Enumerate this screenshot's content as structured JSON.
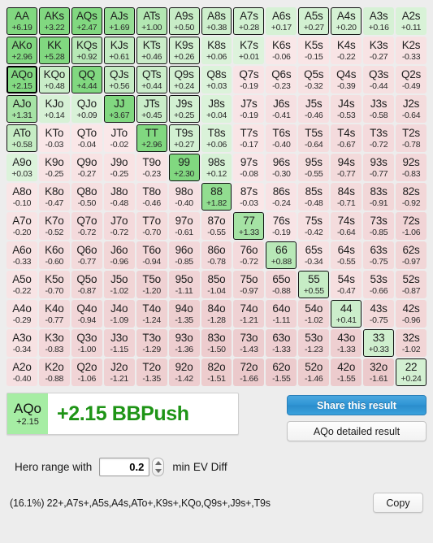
{
  "grid": {
    "rows": [
      [
        {
          "hand": "AA",
          "ev": "+6.19",
          "sel": true
        },
        {
          "hand": "AKs",
          "ev": "+3.22",
          "sel": true
        },
        {
          "hand": "AQs",
          "ev": "+2.47",
          "sel": true
        },
        {
          "hand": "AJs",
          "ev": "+1.69",
          "sel": true
        },
        {
          "hand": "ATs",
          "ev": "+1.00",
          "sel": true
        },
        {
          "hand": "A9s",
          "ev": "+0.50",
          "sel": true
        },
        {
          "hand": "A8s",
          "ev": "+0.38",
          "sel": true
        },
        {
          "hand": "A7s",
          "ev": "+0.28",
          "sel": true
        },
        {
          "hand": "A6s",
          "ev": "+0.17",
          "sel": false
        },
        {
          "hand": "A5s",
          "ev": "+0.27",
          "sel": true
        },
        {
          "hand": "A4s",
          "ev": "+0.20",
          "sel": true
        },
        {
          "hand": "A3s",
          "ev": "+0.16",
          "sel": false
        },
        {
          "hand": "A2s",
          "ev": "+0.11",
          "sel": false
        }
      ],
      [
        {
          "hand": "AKo",
          "ev": "+2.96",
          "sel": true
        },
        {
          "hand": "KK",
          "ev": "+5.28",
          "sel": true
        },
        {
          "hand": "KQs",
          "ev": "+0.92",
          "sel": true
        },
        {
          "hand": "KJs",
          "ev": "+0.61",
          "sel": true
        },
        {
          "hand": "KTs",
          "ev": "+0.46",
          "sel": true
        },
        {
          "hand": "K9s",
          "ev": "+0.26",
          "sel": true
        },
        {
          "hand": "K8s",
          "ev": "+0.06",
          "sel": false
        },
        {
          "hand": "K7s",
          "ev": "+0.01",
          "sel": false
        },
        {
          "hand": "K6s",
          "ev": "-0.06",
          "sel": false
        },
        {
          "hand": "K5s",
          "ev": "-0.15",
          "sel": false
        },
        {
          "hand": "K4s",
          "ev": "-0.22",
          "sel": false
        },
        {
          "hand": "K3s",
          "ev": "-0.27",
          "sel": false
        },
        {
          "hand": "K2s",
          "ev": "-0.33",
          "sel": false
        }
      ],
      [
        {
          "hand": "AQo",
          "ev": "+2.15",
          "sel": true,
          "focus": true
        },
        {
          "hand": "KQo",
          "ev": "+0.48",
          "sel": true
        },
        {
          "hand": "QQ",
          "ev": "+4.44",
          "sel": true
        },
        {
          "hand": "QJs",
          "ev": "+0.56",
          "sel": true
        },
        {
          "hand": "QTs",
          "ev": "+0.44",
          "sel": true
        },
        {
          "hand": "Q9s",
          "ev": "+0.24",
          "sel": true
        },
        {
          "hand": "Q8s",
          "ev": "+0.03",
          "sel": false
        },
        {
          "hand": "Q7s",
          "ev": "-0.19",
          "sel": false
        },
        {
          "hand": "Q6s",
          "ev": "-0.23",
          "sel": false
        },
        {
          "hand": "Q5s",
          "ev": "-0.32",
          "sel": false
        },
        {
          "hand": "Q4s",
          "ev": "-0.39",
          "sel": false
        },
        {
          "hand": "Q3s",
          "ev": "-0.44",
          "sel": false
        },
        {
          "hand": "Q2s",
          "ev": "-0.49",
          "sel": false
        }
      ],
      [
        {
          "hand": "AJo",
          "ev": "+1.31",
          "sel": true
        },
        {
          "hand": "KJo",
          "ev": "+0.14",
          "sel": false
        },
        {
          "hand": "QJo",
          "ev": "+0.09",
          "sel": false
        },
        {
          "hand": "JJ",
          "ev": "+3.67",
          "sel": true
        },
        {
          "hand": "JTs",
          "ev": "+0.45",
          "sel": true
        },
        {
          "hand": "J9s",
          "ev": "+0.25",
          "sel": true
        },
        {
          "hand": "J8s",
          "ev": "+0.04",
          "sel": false
        },
        {
          "hand": "J7s",
          "ev": "-0.19",
          "sel": false
        },
        {
          "hand": "J6s",
          "ev": "-0.41",
          "sel": false
        },
        {
          "hand": "J5s",
          "ev": "-0.46",
          "sel": false
        },
        {
          "hand": "J4s",
          "ev": "-0.53",
          "sel": false
        },
        {
          "hand": "J3s",
          "ev": "-0.58",
          "sel": false
        },
        {
          "hand": "J2s",
          "ev": "-0.64",
          "sel": false
        }
      ],
      [
        {
          "hand": "ATo",
          "ev": "+0.58",
          "sel": true
        },
        {
          "hand": "KTo",
          "ev": "-0.03",
          "sel": false
        },
        {
          "hand": "QTo",
          "ev": "-0.04",
          "sel": false
        },
        {
          "hand": "JTo",
          "ev": "-0.02",
          "sel": false
        },
        {
          "hand": "TT",
          "ev": "+2.96",
          "sel": true
        },
        {
          "hand": "T9s",
          "ev": "+0.27",
          "sel": true
        },
        {
          "hand": "T8s",
          "ev": "+0.06",
          "sel": false
        },
        {
          "hand": "T7s",
          "ev": "-0.17",
          "sel": false
        },
        {
          "hand": "T6s",
          "ev": "-0.40",
          "sel": false
        },
        {
          "hand": "T5s",
          "ev": "-0.64",
          "sel": false
        },
        {
          "hand": "T4s",
          "ev": "-0.67",
          "sel": false
        },
        {
          "hand": "T3s",
          "ev": "-0.72",
          "sel": false
        },
        {
          "hand": "T2s",
          "ev": "-0.78",
          "sel": false
        }
      ],
      [
        {
          "hand": "A9o",
          "ev": "+0.03",
          "sel": false
        },
        {
          "hand": "K9o",
          "ev": "-0.25",
          "sel": false
        },
        {
          "hand": "Q9o",
          "ev": "-0.27",
          "sel": false
        },
        {
          "hand": "J9o",
          "ev": "-0.25",
          "sel": false
        },
        {
          "hand": "T9o",
          "ev": "-0.23",
          "sel": false
        },
        {
          "hand": "99",
          "ev": "+2.30",
          "sel": true
        },
        {
          "hand": "98s",
          "ev": "+0.12",
          "sel": false
        },
        {
          "hand": "97s",
          "ev": "-0.08",
          "sel": false
        },
        {
          "hand": "96s",
          "ev": "-0.30",
          "sel": false
        },
        {
          "hand": "95s",
          "ev": "-0.55",
          "sel": false
        },
        {
          "hand": "94s",
          "ev": "-0.77",
          "sel": false
        },
        {
          "hand": "93s",
          "ev": "-0.77",
          "sel": false
        },
        {
          "hand": "92s",
          "ev": "-0.83",
          "sel": false
        }
      ],
      [
        {
          "hand": "A8o",
          "ev": "-0.10",
          "sel": false
        },
        {
          "hand": "K8o",
          "ev": "-0.47",
          "sel": false
        },
        {
          "hand": "Q8o",
          "ev": "-0.50",
          "sel": false
        },
        {
          "hand": "J8o",
          "ev": "-0.48",
          "sel": false
        },
        {
          "hand": "T8o",
          "ev": "-0.46",
          "sel": false
        },
        {
          "hand": "98o",
          "ev": "-0.40",
          "sel": false
        },
        {
          "hand": "88",
          "ev": "+1.82",
          "sel": true
        },
        {
          "hand": "87s",
          "ev": "-0.03",
          "sel": false
        },
        {
          "hand": "86s",
          "ev": "-0.24",
          "sel": false
        },
        {
          "hand": "85s",
          "ev": "-0.48",
          "sel": false
        },
        {
          "hand": "84s",
          "ev": "-0.71",
          "sel": false
        },
        {
          "hand": "83s",
          "ev": "-0.91",
          "sel": false
        },
        {
          "hand": "82s",
          "ev": "-0.92",
          "sel": false
        }
      ],
      [
        {
          "hand": "A7o",
          "ev": "-0.20",
          "sel": false
        },
        {
          "hand": "K7o",
          "ev": "-0.52",
          "sel": false
        },
        {
          "hand": "Q7o",
          "ev": "-0.72",
          "sel": false
        },
        {
          "hand": "J7o",
          "ev": "-0.72",
          "sel": false
        },
        {
          "hand": "T7o",
          "ev": "-0.70",
          "sel": false
        },
        {
          "hand": "97o",
          "ev": "-0.61",
          "sel": false
        },
        {
          "hand": "87o",
          "ev": "-0.55",
          "sel": false
        },
        {
          "hand": "77",
          "ev": "+1.33",
          "sel": true
        },
        {
          "hand": "76s",
          "ev": "-0.19",
          "sel": false
        },
        {
          "hand": "75s",
          "ev": "-0.42",
          "sel": false
        },
        {
          "hand": "74s",
          "ev": "-0.64",
          "sel": false
        },
        {
          "hand": "73s",
          "ev": "-0.85",
          "sel": false
        },
        {
          "hand": "72s",
          "ev": "-1.06",
          "sel": false
        }
      ],
      [
        {
          "hand": "A6o",
          "ev": "-0.33",
          "sel": false
        },
        {
          "hand": "K6o",
          "ev": "-0.60",
          "sel": false
        },
        {
          "hand": "Q6o",
          "ev": "-0.77",
          "sel": false
        },
        {
          "hand": "J6o",
          "ev": "-0.96",
          "sel": false
        },
        {
          "hand": "T6o",
          "ev": "-0.94",
          "sel": false
        },
        {
          "hand": "96o",
          "ev": "-0.85",
          "sel": false
        },
        {
          "hand": "86o",
          "ev": "-0.78",
          "sel": false
        },
        {
          "hand": "76o",
          "ev": "-0.72",
          "sel": false
        },
        {
          "hand": "66",
          "ev": "+0.88",
          "sel": true
        },
        {
          "hand": "65s",
          "ev": "-0.34",
          "sel": false
        },
        {
          "hand": "64s",
          "ev": "-0.55",
          "sel": false
        },
        {
          "hand": "63s",
          "ev": "-0.75",
          "sel": false
        },
        {
          "hand": "62s",
          "ev": "-0.97",
          "sel": false
        }
      ],
      [
        {
          "hand": "A5o",
          "ev": "-0.22",
          "sel": false
        },
        {
          "hand": "K5o",
          "ev": "-0.70",
          "sel": false
        },
        {
          "hand": "Q5o",
          "ev": "-0.87",
          "sel": false
        },
        {
          "hand": "J5o",
          "ev": "-1.02",
          "sel": false
        },
        {
          "hand": "T5o",
          "ev": "-1.20",
          "sel": false
        },
        {
          "hand": "95o",
          "ev": "-1.11",
          "sel": false
        },
        {
          "hand": "85o",
          "ev": "-1.04",
          "sel": false
        },
        {
          "hand": "75o",
          "ev": "-0.97",
          "sel": false
        },
        {
          "hand": "65o",
          "ev": "-0.88",
          "sel": false
        },
        {
          "hand": "55",
          "ev": "+0.55",
          "sel": true
        },
        {
          "hand": "54s",
          "ev": "-0.47",
          "sel": false
        },
        {
          "hand": "53s",
          "ev": "-0.66",
          "sel": false
        },
        {
          "hand": "52s",
          "ev": "-0.87",
          "sel": false
        }
      ],
      [
        {
          "hand": "A4o",
          "ev": "-0.29",
          "sel": false
        },
        {
          "hand": "K4o",
          "ev": "-0.77",
          "sel": false
        },
        {
          "hand": "Q4o",
          "ev": "-0.94",
          "sel": false
        },
        {
          "hand": "J4o",
          "ev": "-1.09",
          "sel": false
        },
        {
          "hand": "T4o",
          "ev": "-1.24",
          "sel": false
        },
        {
          "hand": "94o",
          "ev": "-1.35",
          "sel": false
        },
        {
          "hand": "84o",
          "ev": "-1.28",
          "sel": false
        },
        {
          "hand": "74o",
          "ev": "-1.21",
          "sel": false
        },
        {
          "hand": "64o",
          "ev": "-1.11",
          "sel": false
        },
        {
          "hand": "54o",
          "ev": "-1.02",
          "sel": false
        },
        {
          "hand": "44",
          "ev": "+0.41",
          "sel": true
        },
        {
          "hand": "43s",
          "ev": "-0.75",
          "sel": false
        },
        {
          "hand": "42s",
          "ev": "-0.96",
          "sel": false
        }
      ],
      [
        {
          "hand": "A3o",
          "ev": "-0.34",
          "sel": false
        },
        {
          "hand": "K3o",
          "ev": "-0.83",
          "sel": false
        },
        {
          "hand": "Q3o",
          "ev": "-1.00",
          "sel": false
        },
        {
          "hand": "J3o",
          "ev": "-1.15",
          "sel": false
        },
        {
          "hand": "T3o",
          "ev": "-1.29",
          "sel": false
        },
        {
          "hand": "93o",
          "ev": "-1.36",
          "sel": false
        },
        {
          "hand": "83o",
          "ev": "-1.50",
          "sel": false
        },
        {
          "hand": "73o",
          "ev": "-1.43",
          "sel": false
        },
        {
          "hand": "63o",
          "ev": "-1.33",
          "sel": false
        },
        {
          "hand": "53o",
          "ev": "-1.23",
          "sel": false
        },
        {
          "hand": "43o",
          "ev": "-1.33",
          "sel": false
        },
        {
          "hand": "33",
          "ev": "+0.33",
          "sel": true
        },
        {
          "hand": "32s",
          "ev": "-1.02",
          "sel": false
        }
      ],
      [
        {
          "hand": "A2o",
          "ev": "-0.40",
          "sel": false
        },
        {
          "hand": "K2o",
          "ev": "-0.88",
          "sel": false
        },
        {
          "hand": "Q2o",
          "ev": "-1.06",
          "sel": false
        },
        {
          "hand": "J2o",
          "ev": "-1.21",
          "sel": false
        },
        {
          "hand": "T2o",
          "ev": "-1.35",
          "sel": false
        },
        {
          "hand": "92o",
          "ev": "-1.42",
          "sel": false
        },
        {
          "hand": "82o",
          "ev": "-1.51",
          "sel": false
        },
        {
          "hand": "72o",
          "ev": "-1.66",
          "sel": false
        },
        {
          "hand": "62o",
          "ev": "-1.55",
          "sel": false
        },
        {
          "hand": "52o",
          "ev": "-1.46",
          "sel": false
        },
        {
          "hand": "42o",
          "ev": "-1.55",
          "sel": false
        },
        {
          "hand": "32o",
          "ev": "-1.61",
          "sel": false
        },
        {
          "hand": "22",
          "ev": "+0.24",
          "sel": true
        }
      ]
    ]
  },
  "result": {
    "hand": "AQo",
    "hand_ev": "+2.15",
    "text": "+2.15 BBPush",
    "share_label": "Share this result",
    "detail_label": "AQo detailed result"
  },
  "hero": {
    "label": "Hero range with",
    "value": "0.2",
    "suffix": "min EV Diff"
  },
  "range": {
    "string": "(16.1%) 22+,A7s+,A5s,A4s,ATo+,K9s+,KQo,Q9s+,J9s+,T9s",
    "copy_label": "Copy"
  },
  "colors": {
    "positive_strong": "#7fdc7c",
    "positive": "#cdf0cc",
    "negative": "#f4d5d7",
    "accent_blue": "#2e94d4",
    "result_green": "#1e9416"
  }
}
